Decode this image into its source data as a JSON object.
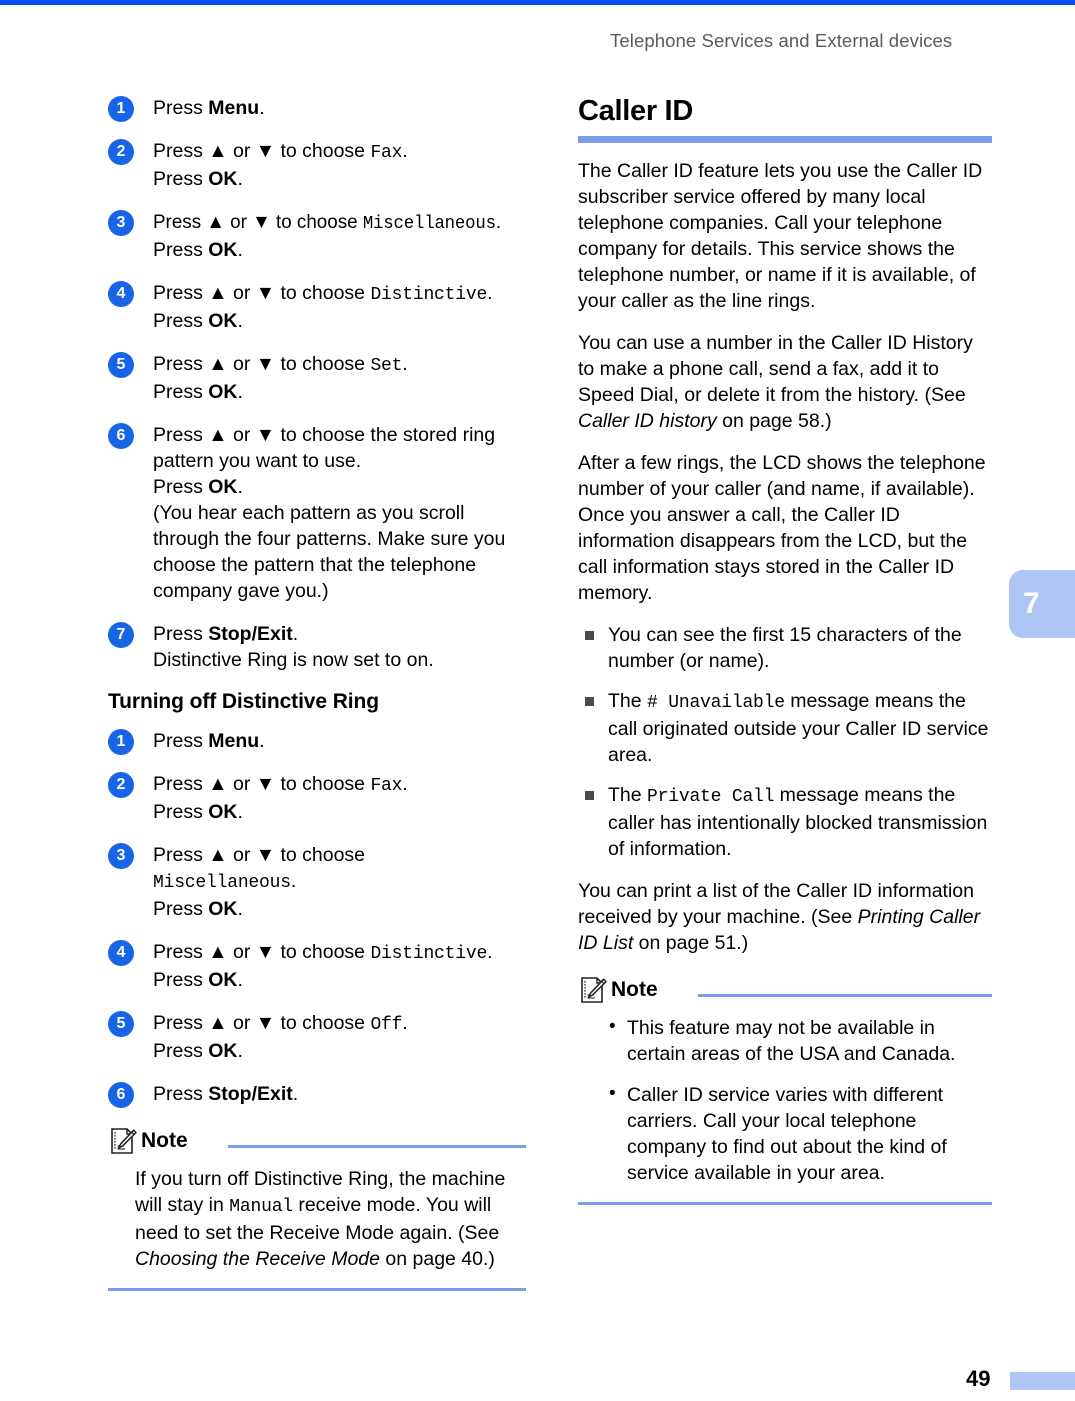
{
  "page": {
    "running_head": "Telephone Services and External devices",
    "chapter_tab": "7",
    "page_number": "49",
    "accent_blue": "#7b9ce8",
    "rule_blue": "#0a4ff0",
    "tab_blue": "#aec6f5",
    "step_circle_blue": "#1764e8"
  },
  "left_column": {
    "steps_on": [
      {
        "num": "1",
        "lines": [
          {
            "pre": "Press ",
            "bold": "Menu",
            "post": "."
          }
        ]
      },
      {
        "num": "2",
        "lines": [
          {
            "pre": "Press ▲ or ▼ to choose ",
            "mono": "Fax",
            "post": "."
          },
          {
            "pre": "Press ",
            "bold": "OK",
            "post": "."
          }
        ]
      },
      {
        "num": "3",
        "lines": [
          {
            "pre": "Press ▲ or ▼ to choose ",
            "mono": "Miscellaneous",
            "post": ".",
            "condensed": true
          },
          {
            "pre": "Press ",
            "bold": "OK",
            "post": "."
          }
        ]
      },
      {
        "num": "4",
        "lines": [
          {
            "pre": "Press ▲ or ▼ to choose ",
            "mono": "Distinctive",
            "post": "."
          },
          {
            "pre": "Press ",
            "bold": "OK",
            "post": "."
          }
        ]
      },
      {
        "num": "5",
        "lines": [
          {
            "pre": "Press ▲ or ▼ to choose ",
            "mono": "Set",
            "post": "."
          },
          {
            "pre": "Press ",
            "bold": "OK",
            "post": "."
          }
        ]
      },
      {
        "num": "6",
        "lines": [
          {
            "wrap": "Press ▲ or ▼ to choose the stored ring pattern you want to use."
          },
          {
            "pre": "Press ",
            "bold": "OK",
            "post": "."
          },
          {
            "wrap": "(You hear each pattern as you scroll through the four patterns. Make sure you choose the pattern that the telephone company gave you.)"
          }
        ]
      },
      {
        "num": "7",
        "lines": [
          {
            "pre": "Press ",
            "bold": "Stop/Exit",
            "post": "."
          },
          {
            "wrap": "Distinctive Ring is now set to on."
          }
        ]
      }
    ],
    "section_heading": "Turning off Distinctive Ring",
    "steps_off": [
      {
        "num": "1",
        "lines": [
          {
            "pre": "Press ",
            "bold": "Menu",
            "post": "."
          }
        ]
      },
      {
        "num": "2",
        "lines": [
          {
            "pre": "Press ▲ or ▼ to choose ",
            "mono": "Fax",
            "post": "."
          },
          {
            "pre": "Press ",
            "bold": "OK",
            "post": "."
          }
        ]
      },
      {
        "num": "3",
        "lines": [
          {
            "pre": "Press ▲ or ▼ to choose"
          },
          {
            "mono_only": "Miscellaneous",
            "post": "."
          },
          {
            "pre": "Press ",
            "bold": "OK",
            "post": "."
          }
        ]
      },
      {
        "num": "4",
        "lines": [
          {
            "pre": "Press ▲ or ▼ to choose ",
            "mono": "Distinctive",
            "post": "."
          },
          {
            "pre": "Press ",
            "bold": "OK",
            "post": "."
          }
        ]
      },
      {
        "num": "5",
        "lines": [
          {
            "pre": "Press ▲ or ▼ to choose ",
            "mono": "Off",
            "post": "."
          },
          {
            "pre": "Press ",
            "bold": "OK",
            "post": "."
          }
        ]
      },
      {
        "num": "6",
        "lines": [
          {
            "pre": "Press ",
            "bold": "Stop/Exit",
            "post": "."
          }
        ]
      }
    ],
    "note": {
      "label": "Note",
      "text_parts": {
        "p1": "If you turn off Distinctive Ring, the machine will stay in ",
        "mono1": "Manual",
        "p2": " receive mode. You will need to set the Receive Mode again. (See ",
        "italic1": "Choosing the Receive Mode",
        "p3": " on page 40.)"
      }
    }
  },
  "right_column": {
    "heading": "Caller ID",
    "para1": "The Caller ID feature lets you use the Caller ID subscriber service offered by many local telephone companies. Call your telephone company for details. This service shows the telephone number, or name if it is available, of your caller as the line rings.",
    "para2": {
      "p1": "You can use a number in the Caller ID History to make a phone call, send a fax, add it to Speed Dial, or delete it from the history. (See ",
      "italic1": "Caller ID history",
      "p2": " on page 58.)"
    },
    "para3": "After a few rings, the LCD shows the telephone number of your caller (and name, if available). Once you answer a call, the Caller ID information disappears from the LCD, but the call information stays stored in the Caller ID memory.",
    "bullets": [
      {
        "p1": "You can see the first 15 characters of the number (or name)."
      },
      {
        "p1": "The ",
        "mono1": "#  Unavailable",
        "p2": " message means the call originated outside your Caller ID service area."
      },
      {
        "p1": "The ",
        "mono1": "Private Call",
        "p2": " message means the caller has intentionally blocked transmission of information."
      }
    ],
    "para4": {
      "p1": "You can print a list of the Caller ID information received by your machine. (See ",
      "italic1": "Printing Caller ID List",
      "p2": " on page 51.)"
    },
    "note": {
      "label": "Note",
      "items": [
        "This feature may not be available in certain areas of the USA and Canada.",
        "Caller ID service varies with different carriers. Call your local telephone company to find out about the kind of service available in your area."
      ]
    }
  }
}
